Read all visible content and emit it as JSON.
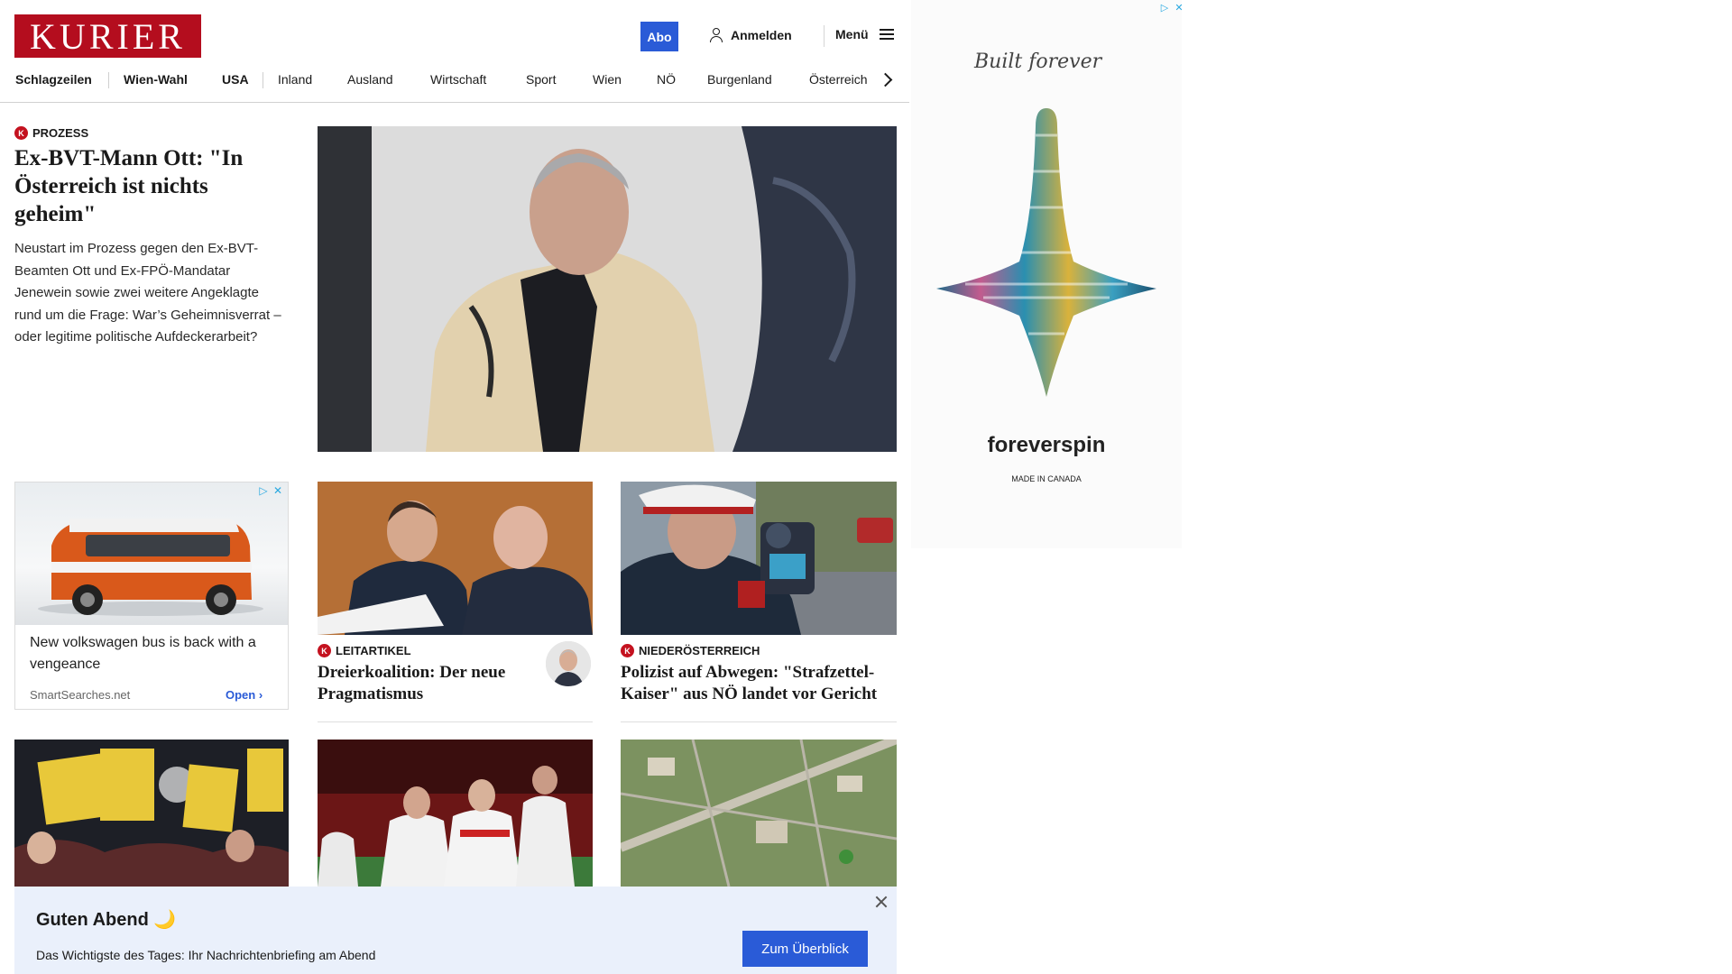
{
  "header": {
    "logo": "KURIER",
    "abo_label": "Abo",
    "login_label": "Anmelden",
    "menu_label": "Menü"
  },
  "nav": {
    "items": [
      "Schlagzeilen",
      "Wien-Wahl",
      "USA",
      "Inland",
      "Ausland",
      "Wirtschaft",
      "Sport",
      "Wien",
      "NÖ",
      "Burgenland",
      "Österreich"
    ]
  },
  "lead": {
    "kicker": "PROZESS",
    "title": "Ex-BVT-Mann Ott: \"In Österreich ist nichts geheim\"",
    "teaser": "Neustart im Prozess gegen den Ex-BVT-Beamten Ott und Ex-FPÖ-Mandatar Jenewein sowie zwei weitere Angeklagte rund um die Frage: War’s Geheimnisverrat – oder legitime politische Aufdeckerarbeit?"
  },
  "ad_card": {
    "title": "New volkswagen bus is back with a vengeance",
    "source": "SmartSearches.net",
    "open_label": "Open",
    "close_icon": "close-icon",
    "info_icon": "ad-choices-icon"
  },
  "cards": [
    {
      "kicker": "LEITARTIKEL",
      "title": "Dreierkoalition: Der neue Pragmatismus"
    },
    {
      "kicker": "NIEDERÖSTERREICH",
      "title": "Polizist auf Abwegen: \"Strafzettel-Kaiser\" aus NÖ landet vor Gericht"
    }
  ],
  "side_ad": {
    "tagline": "Built forever",
    "brand": "foreverspin",
    "made_in": "MADE IN CANADA"
  },
  "briefing": {
    "title": "Guten Abend",
    "moon": "🌙",
    "text": "Das Wichtigste des Tages: Ihr Nachrichtenbriefing am Abend",
    "button_label": "Zum Überblick"
  },
  "colors": {
    "brand_red": "#b40d1e",
    "accent_blue": "#2a5bd7",
    "briefing_bg": "#eaf0fb"
  }
}
